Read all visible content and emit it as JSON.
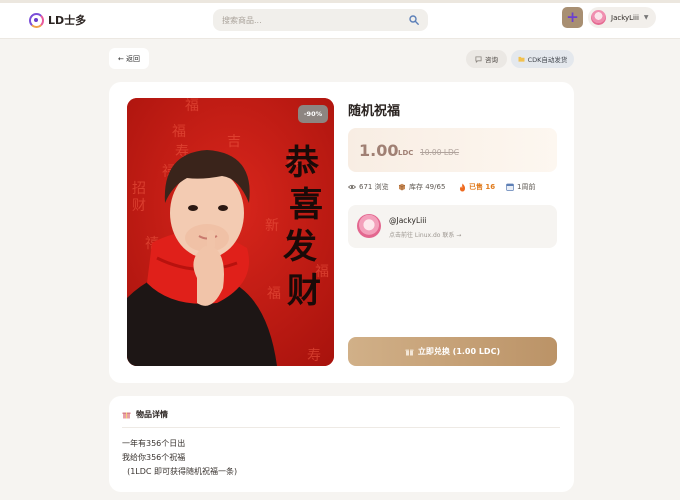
{
  "header": {
    "logo_text": "LD士多",
    "search_placeholder": "搜索商品...",
    "user_name": "JackyLiii"
  },
  "actions": {
    "back_label": "← 返回",
    "ask_label": "咨询",
    "cdk_label": "CDK自动发货"
  },
  "product": {
    "discount": "-90%",
    "title": "随机祝福",
    "price": "1.00",
    "price_unit": "LDC",
    "original_price": "10.00 LDC",
    "views": "671 浏览",
    "stock": "库存 49/65",
    "sold": "已售 16",
    "time": "1周前",
    "image_text": "恭喜发财"
  },
  "seller": {
    "name": "@JackyLiii",
    "link": "点击前往 Linux.do 联系 →"
  },
  "buy_label": "立即兑换 (1.00 LDC)",
  "details": {
    "title": "物品详情",
    "lines": [
      "一年有356个日出",
      "我给你356个祝福",
      "  (1LDC 即可获得随机祝福一条)"
    ]
  },
  "icons": [
    "logo-icon",
    "search-icon",
    "plus-icon",
    "eye-icon",
    "box-icon",
    "fire-icon",
    "calendar-icon",
    "gift-icon",
    "chat-icon",
    "folder-icon"
  ],
  "colors": {
    "accent": "#c7a57c",
    "discount_bg": "#8d8581",
    "sold": "#e07a1b",
    "plus_bg": "#a88f72"
  }
}
